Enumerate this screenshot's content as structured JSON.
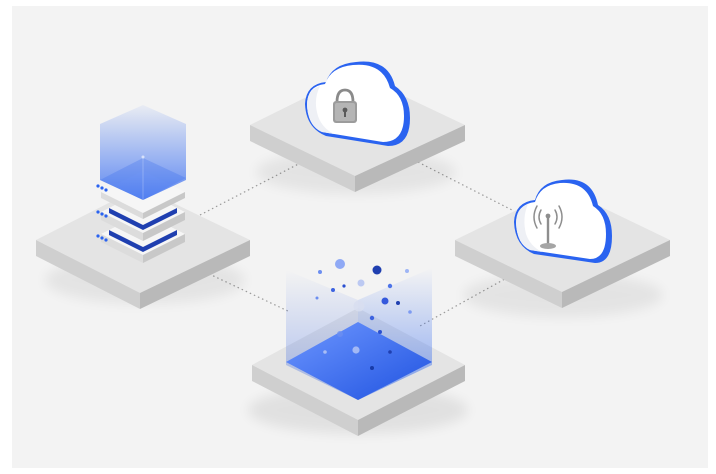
{
  "scene": {
    "colors": {
      "background": "#f3f3f3",
      "platform_top": "#e4e4e4",
      "platform_left": "#cfcfcf",
      "platform_right": "#b9b9b9",
      "accent_blue": "#2a63f0",
      "deep_blue": "#1f3fb0",
      "cloud_white": "#ffffff",
      "cloud_shadow": "#e8ebf2",
      "connector": "#9a9a9a"
    },
    "nodes": [
      {
        "name": "server-stack-node",
        "icon": "server-stack-icon"
      },
      {
        "name": "secure-cloud-node",
        "icon": "padlock-icon"
      },
      {
        "name": "wireless-cloud-node",
        "icon": "antenna-icon"
      },
      {
        "name": "data-lake-node",
        "icon": "data-particles-icon"
      }
    ],
    "connectors": [
      {
        "from": "server-stack-node",
        "to": "secure-cloud-node",
        "style": "dotted"
      },
      {
        "from": "secure-cloud-node",
        "to": "wireless-cloud-node",
        "style": "dotted"
      },
      {
        "from": "server-stack-node",
        "to": "data-lake-node",
        "style": "dotted"
      },
      {
        "from": "wireless-cloud-node",
        "to": "data-lake-node",
        "style": "dotted"
      }
    ]
  }
}
